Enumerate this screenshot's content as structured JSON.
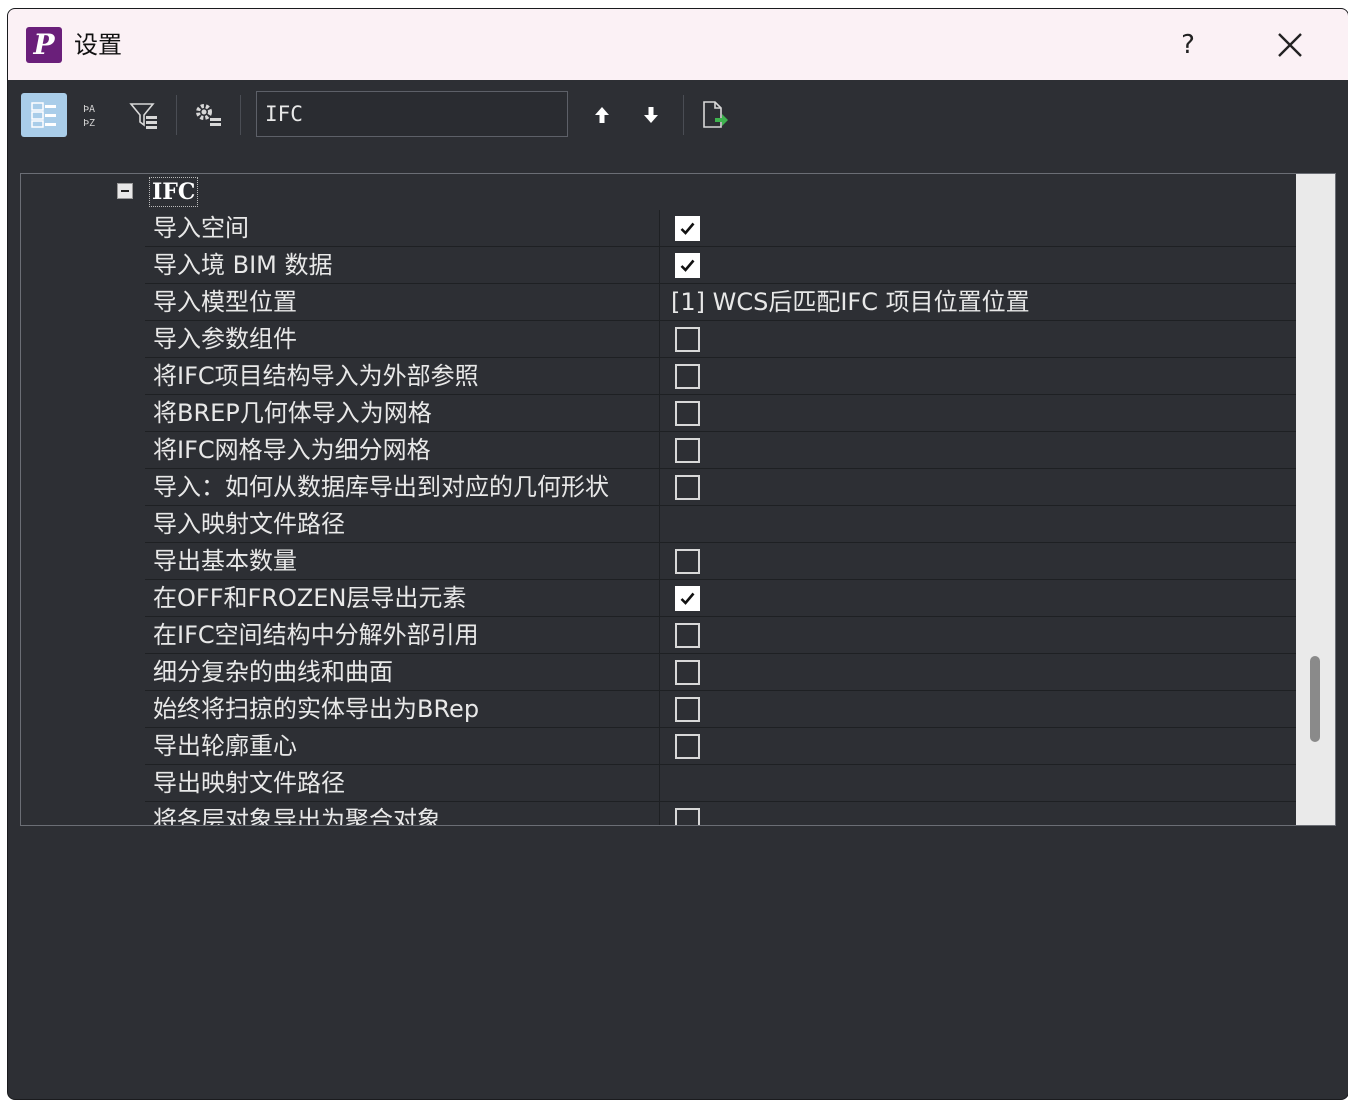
{
  "window": {
    "title": "设置",
    "logo_letter": "P",
    "help_label": "?",
    "close_label": "✕"
  },
  "toolbar": {
    "search_value": "IFC",
    "buttons": [
      "categorized-view-icon",
      "alphabetical-sort-icon",
      "filter-icon",
      "settings-icon",
      "arrow-up-icon",
      "arrow-down-icon",
      "export-icon"
    ]
  },
  "category": {
    "label": "IFC",
    "expanded": true
  },
  "properties": [
    {
      "name": "导入空间",
      "type": "checkbox",
      "checked": true
    },
    {
      "name": "导入境 BIM 数据",
      "type": "checkbox",
      "checked": true
    },
    {
      "name": "导入模型位置",
      "type": "text",
      "value": "[1] WCS后匹配IFC 项目位置位置"
    },
    {
      "name": "导入参数组件",
      "type": "checkbox",
      "checked": false
    },
    {
      "name": "将IFC项目结构导入为外部参照",
      "type": "checkbox",
      "checked": false
    },
    {
      "name": "将BREP几何体导入为网格",
      "type": "checkbox",
      "checked": false
    },
    {
      "name": "将IFC网格导入为细分网格",
      "type": "checkbox",
      "checked": false
    },
    {
      "name": "导入：如何从数据库导出到对应的几何形状",
      "type": "checkbox",
      "checked": false
    },
    {
      "name": "导入映射文件路径",
      "type": "text",
      "value": ""
    },
    {
      "name": "导出基本数量",
      "type": "checkbox",
      "checked": false
    },
    {
      "name": "在OFF和FROZEN层导出元素",
      "type": "checkbox",
      "checked": true
    },
    {
      "name": "在IFC空间结构中分解外部引用",
      "type": "checkbox",
      "checked": false
    },
    {
      "name": "细分复杂的曲线和曲面",
      "type": "checkbox",
      "checked": false
    },
    {
      "name": "始终将扫掠的实体导出为BRep",
      "type": "checkbox",
      "checked": false
    },
    {
      "name": "导出轮廓重心",
      "type": "checkbox",
      "checked": false
    },
    {
      "name": "导出映射文件路径",
      "type": "text",
      "value": ""
    },
    {
      "name": "将各层对象导出为聚合对象",
      "type": "checkbox",
      "checked": false
    }
  ],
  "colors": {
    "background": "#2d2f34",
    "titlebar": "#fbf1f5",
    "active_button": "#a9cde9",
    "logo": "#6a1f7a"
  }
}
